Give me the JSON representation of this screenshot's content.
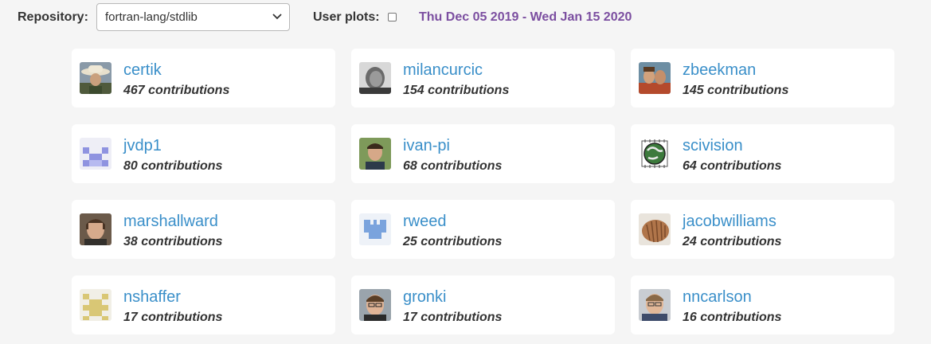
{
  "header": {
    "repo_label": "Repository:",
    "repo_selected": "fortran-lang/stdlib",
    "userplots_label": "User plots:",
    "userplots_checked": false,
    "date_range": "Thu Dec 05 2019 - Wed Jan 15 2020"
  },
  "contributors": [
    {
      "username": "certik",
      "contributions": "467 contributions",
      "avatar": "photo-cowboy-hat"
    },
    {
      "username": "milancurcic",
      "contributions": "154 contributions",
      "avatar": "photo-bw-portrait"
    },
    {
      "username": "zbeekman",
      "contributions": "145 contributions",
      "avatar": "photo-two-people"
    },
    {
      "username": "jvdp1",
      "contributions": "80 contributions",
      "avatar": "identicon-blue"
    },
    {
      "username": "ivan-pi",
      "contributions": "68 contributions",
      "avatar": "photo-portrait"
    },
    {
      "username": "scivision",
      "contributions": "64 contributions",
      "avatar": "globe-chip-logo"
    },
    {
      "username": "marshallward",
      "contributions": "38 contributions",
      "avatar": "photo-portrait"
    },
    {
      "username": "rweed",
      "contributions": "25 contributions",
      "avatar": "identicon-blue-castle"
    },
    {
      "username": "jacobwilliams",
      "contributions": "24 contributions",
      "avatar": "photo-shell"
    },
    {
      "username": "nshaffer",
      "contributions": "17 contributions",
      "avatar": "identicon-yellow"
    },
    {
      "username": "gronki",
      "contributions": "17 contributions",
      "avatar": "photo-portrait"
    },
    {
      "username": "nncarlson",
      "contributions": "16 contributions",
      "avatar": "photo-portrait"
    }
  ]
}
